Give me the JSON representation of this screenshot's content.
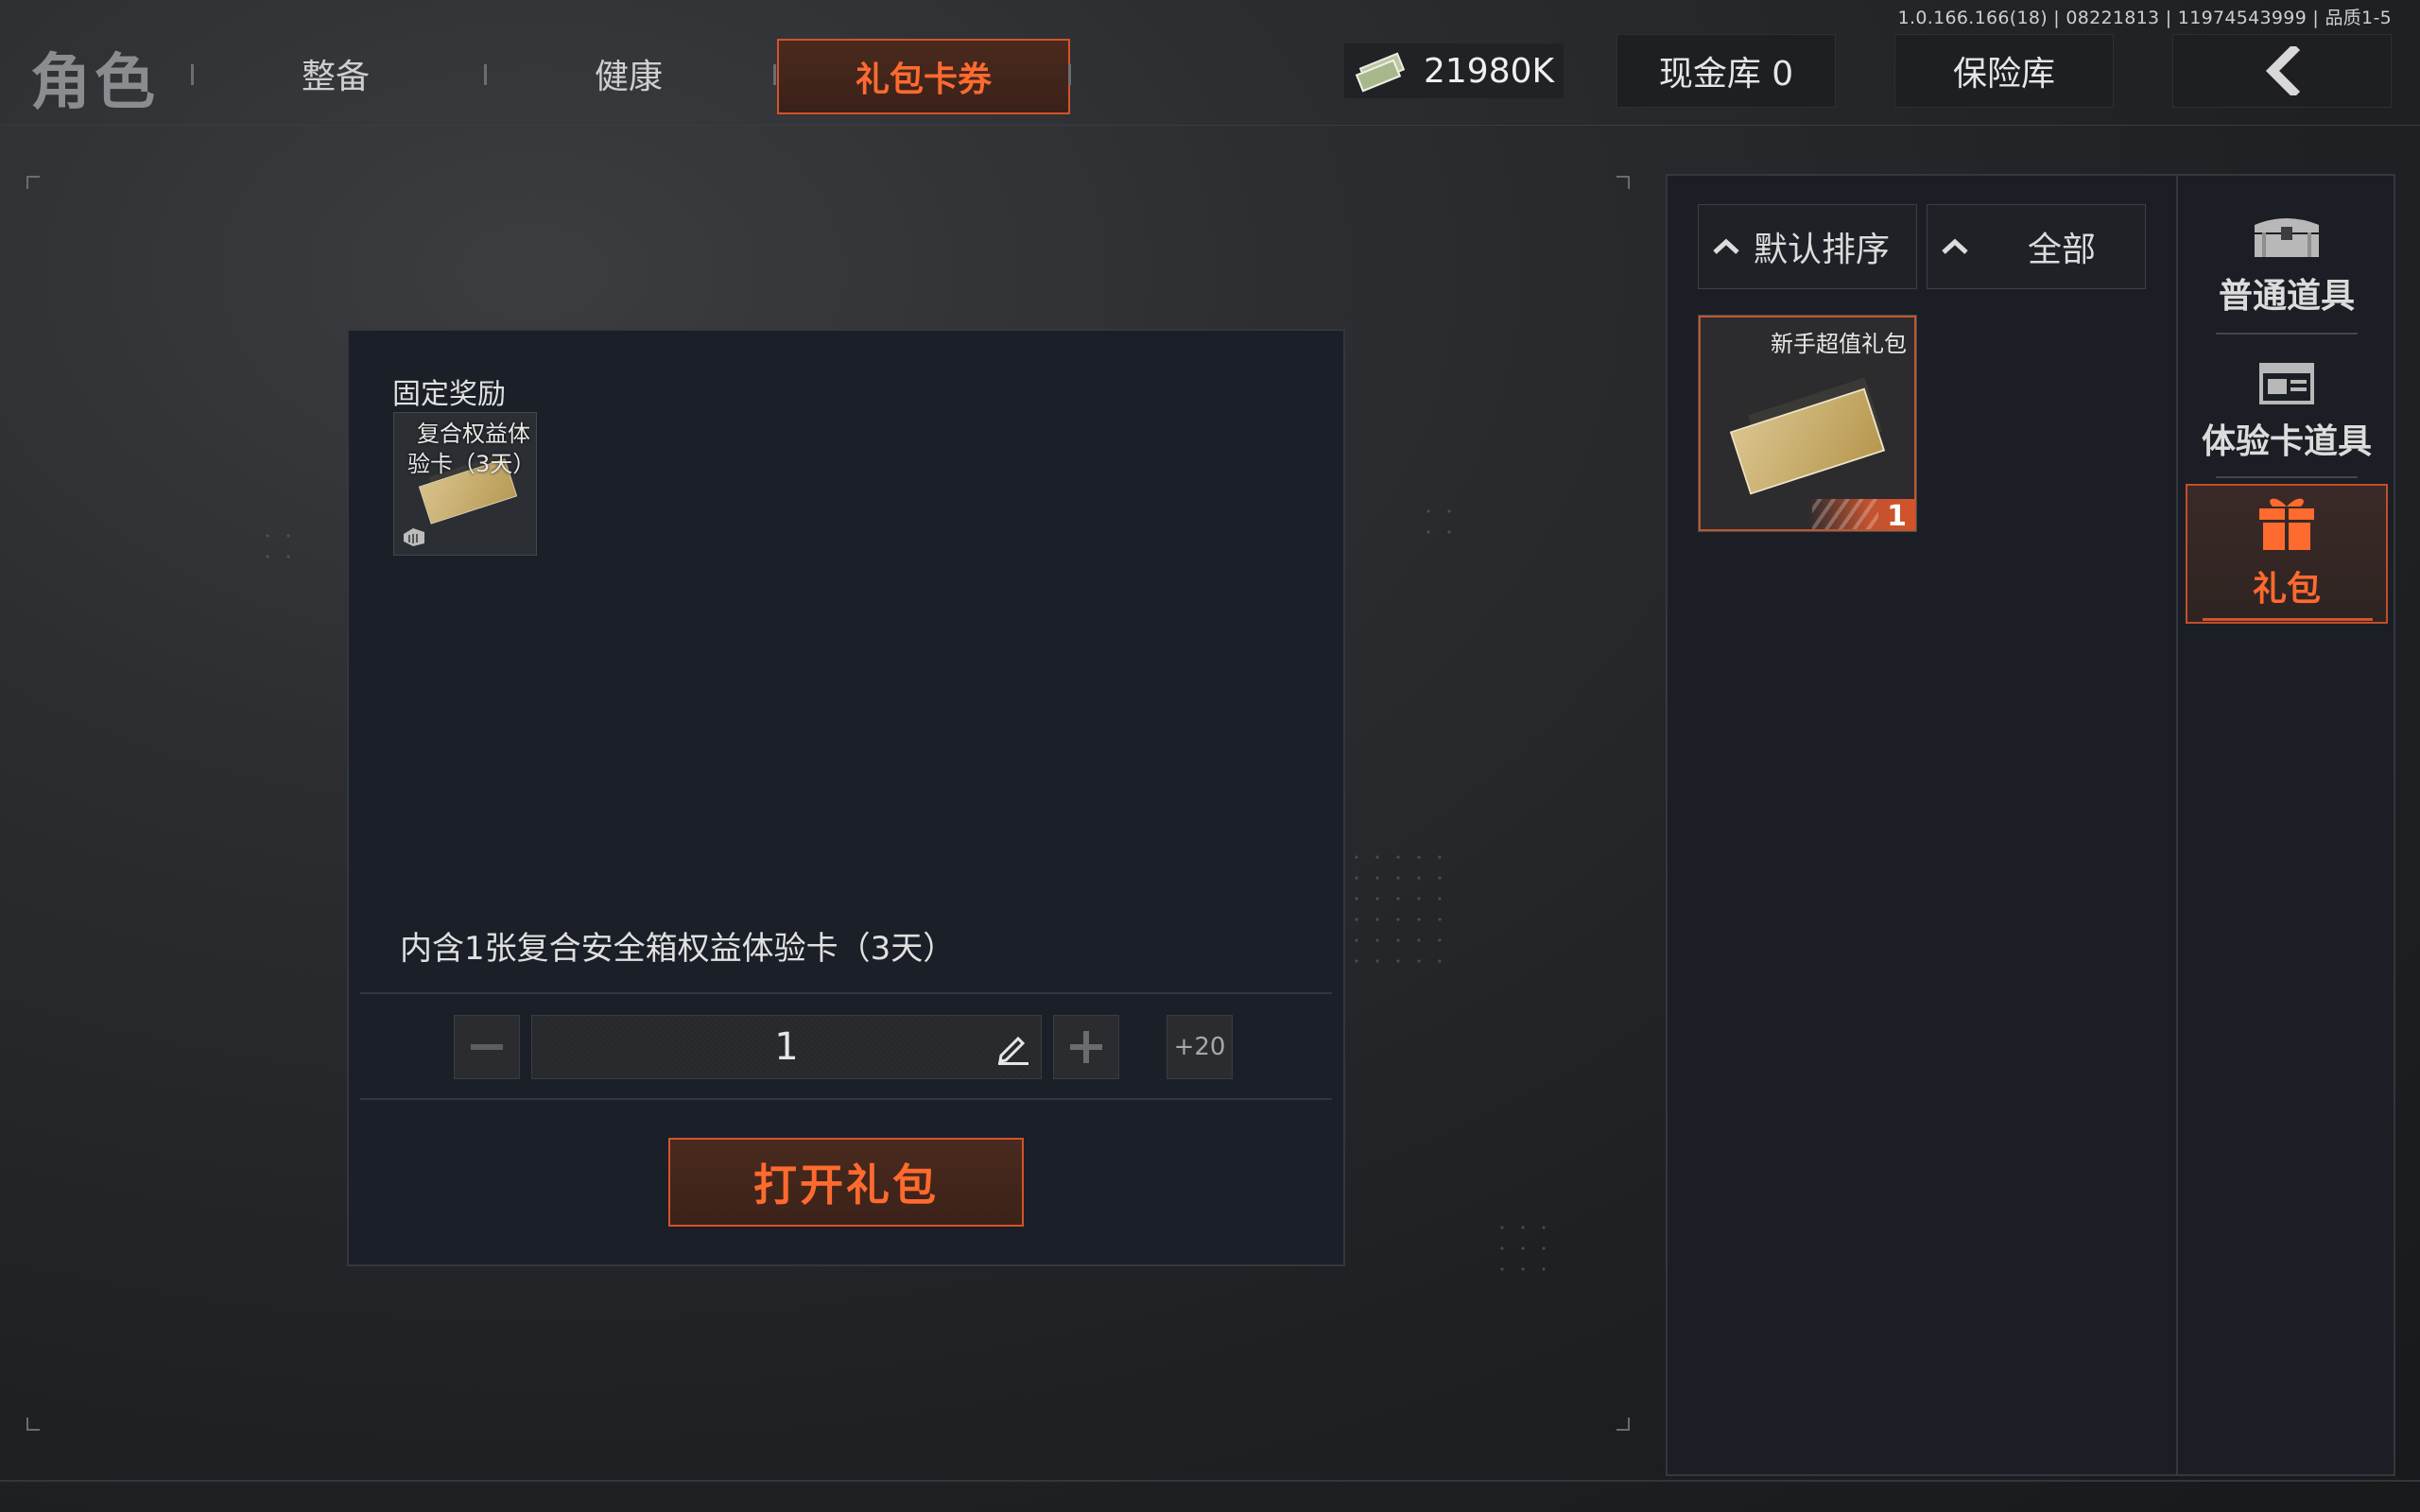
{
  "version": "1.0.166.166(18) | 08221813 | 11974543999 | 品质1-5",
  "nav": {
    "title": "角色",
    "tabs": [
      "整备",
      "健康",
      "礼包卡券"
    ],
    "active_tab": "礼包卡券"
  },
  "header": {
    "money": "21980K",
    "cash_vault": "现金库 0",
    "safe_vault": "保险库"
  },
  "gift_panel": {
    "fixed_reward_label": "固定奖励",
    "reward_item_name": "复合权益体验卡（3天）",
    "description": "内含1张复合安全箱权益体验卡（3天）",
    "quantity": "1",
    "plus20_label": "+20",
    "open_button": "打开礼包"
  },
  "inventory": {
    "sort_label": "默认排序",
    "filter_label": "全部",
    "items": [
      {
        "name": "新手超值礼包",
        "count": "1"
      }
    ]
  },
  "categories": [
    {
      "label": "普通道具",
      "icon": "chest-icon",
      "active": false
    },
    {
      "label": "体验卡道具",
      "icon": "card-icon",
      "active": false
    },
    {
      "label": "礼包",
      "icon": "gift-icon",
      "active": true
    }
  ],
  "colors": {
    "accent": "#ff6a2e",
    "accent_border": "#d4532a",
    "panel_bg": "#1b1f27"
  }
}
